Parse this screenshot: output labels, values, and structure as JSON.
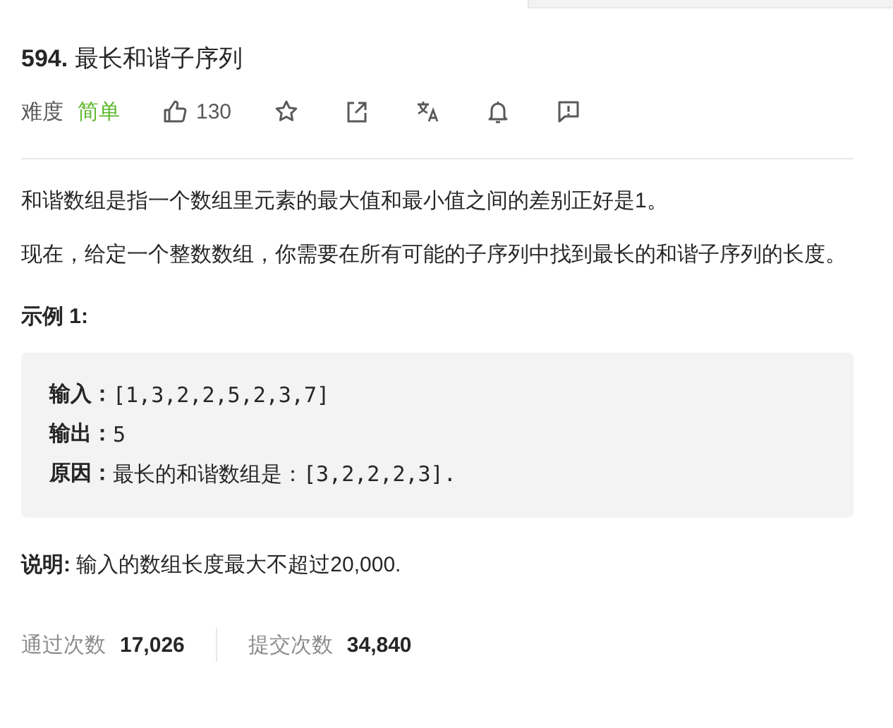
{
  "problem": {
    "number": "594.",
    "title": "最长和谐子序列"
  },
  "meta": {
    "difficulty_label": "难度",
    "difficulty": "简单",
    "likes": "130"
  },
  "description": [
    "和谐数组是指一个数组里元素的最大值和最小值之间的差别正好是1。",
    "现在，给定一个整数数组，你需要在所有可能的子序列中找到最长的和谐子序列的长度。"
  ],
  "example": {
    "heading": "示例 1:",
    "lines": [
      {
        "label": "输入：",
        "value": "[1,3,2,2,5,2,3,7]"
      },
      {
        "label": "输出：",
        "value": "5"
      },
      {
        "label": "原因：",
        "value": "最长的和谐数组是：[3,2,2,2,3]."
      }
    ]
  },
  "note": "**说明:** 输入的数组长度最大不超过20,000.",
  "stats": [
    {
      "label": "通过次数",
      "value": "17,026"
    },
    {
      "label": "提交次数",
      "value": "34,840"
    }
  ]
}
